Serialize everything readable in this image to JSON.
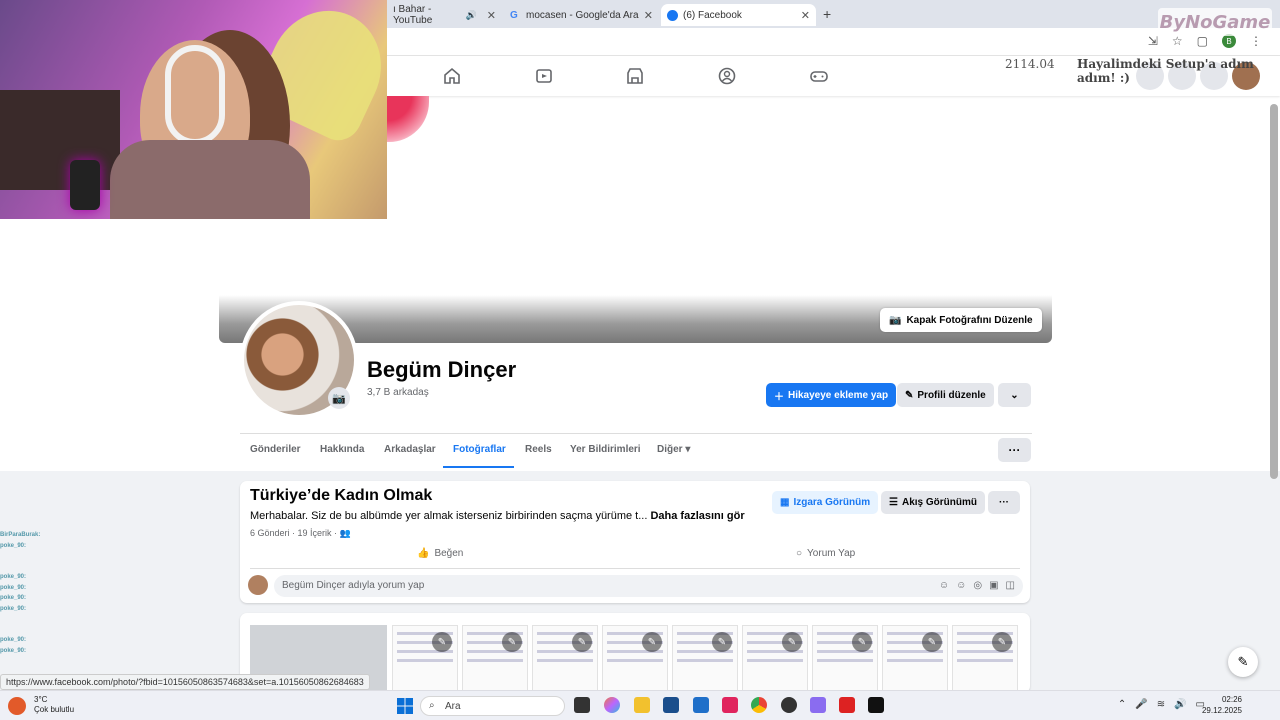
{
  "browser": {
    "tabs": [
      {
        "label": "ı Bahar - YouTube",
        "active": false
      },
      {
        "label": "mocasen - Google'da Ara",
        "active": false
      },
      {
        "label": "(6) Facebook",
        "active": true
      }
    ]
  },
  "overlay": {
    "counter": "2114.04",
    "slogan": "Hayalimdeki Setup'a adım adım! :)",
    "watermark": "ByNoGame"
  },
  "profile": {
    "cover_button": "Kapak Fotoğrafını Düzenle",
    "name": "Begüm Dinçer",
    "friends": "3,7 B arkadaş",
    "add_story": "Hikayeye ekleme yap",
    "edit_profile": "Profili düzenle",
    "tabs": [
      "Gönderiler",
      "Hakkında",
      "Arkadaşlar",
      "Fotoğraflar",
      "Reels",
      "Yer Bildirimleri",
      "Diğer"
    ],
    "active_tab": "Fotoğraflar"
  },
  "album": {
    "title": "Türkiye’de Kadın Olmak",
    "description": "Merhabalar. Siz de bu albümde yer almak isterseniz birbirinden saçma yürüme t...",
    "see_more": "Daha fazlasını gör",
    "meta": "6 Gönderi · 19 İçerik ·",
    "grid_view": "Izgara Görünüm",
    "feed_view": "Akış Görünümü",
    "like": "Beğen",
    "comment": "Yorum Yap",
    "comment_placeholder": "Begüm Dinçer adıyla yorum yap"
  },
  "status_url": "https://www.facebook.com/photo/?fbid=10156050863574683&set=a.10156050862684683",
  "chat": [
    {
      "user": "BirParaBurak:",
      "text": ""
    },
    {
      "user": "poke_90:",
      "text": ""
    },
    {
      "user": "poke_90:",
      "text": ""
    },
    {
      "user": "poke_90:",
      "text": ""
    },
    {
      "user": "poke_90:",
      "text": ""
    },
    {
      "user": "poke_90:",
      "text": ""
    },
    {
      "user": "poke_90:",
      "text": ""
    },
    {
      "user": "poke_90:",
      "text": ""
    }
  ],
  "taskbar": {
    "search": "Ara",
    "weather_temp": "3°C",
    "weather_desc": "Çok bulutlu",
    "time": "02:26",
    "date": "29.12.2025"
  }
}
